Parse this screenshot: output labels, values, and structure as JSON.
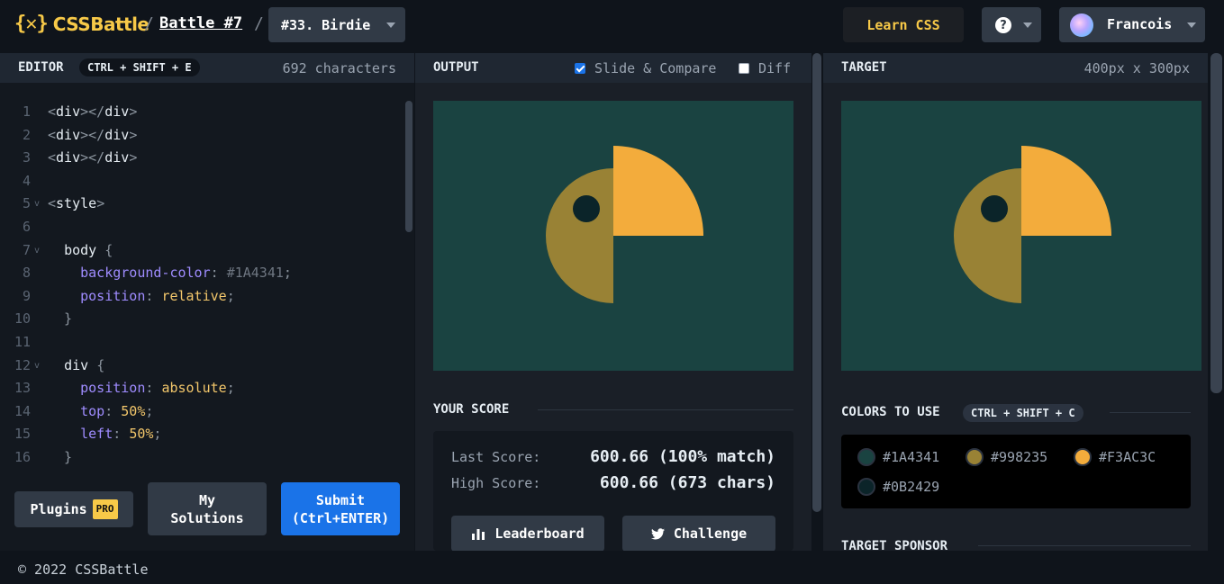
{
  "header": {
    "logo_mark": "{✕}",
    "logo_text": "CSSBattle",
    "separator": "/",
    "battle": "Battle #7",
    "target_name": "#33. Birdie",
    "learn": "Learn CSS",
    "help": "?",
    "user": "Francois"
  },
  "editor": {
    "title": "EDITOR",
    "shortcut": "CTRL + SHIFT + E",
    "chars": "692 characters",
    "lines": [
      {
        "n": "1",
        "text": "<div></div>"
      },
      {
        "n": "2",
        "text": "<div></div>"
      },
      {
        "n": "3",
        "text": "<div></div>"
      },
      {
        "n": "4",
        "text": ""
      },
      {
        "n": "5",
        "text": "<style>"
      },
      {
        "n": "6",
        "text": ""
      },
      {
        "n": "7",
        "text": "  body {"
      },
      {
        "n": "8",
        "text": "    background-color: #1A4341;"
      },
      {
        "n": "9",
        "text": "    position: relative;"
      },
      {
        "n": "10",
        "text": "  }"
      },
      {
        "n": "11",
        "text": ""
      },
      {
        "n": "12",
        "text": "  div {"
      },
      {
        "n": "13",
        "text": "    position: absolute;"
      },
      {
        "n": "14",
        "text": "    top: 50%;"
      },
      {
        "n": "15",
        "text": "    left: 50%;"
      },
      {
        "n": "16",
        "text": "  }"
      }
    ],
    "plugins": "Plugins",
    "pro": "PRO",
    "my_solutions_1": "My",
    "my_solutions_2": "Solutions",
    "submit_1": "Submit",
    "submit_2": "(Ctrl+ENTER)"
  },
  "output": {
    "title": "OUTPUT",
    "slide_compare": "Slide & Compare",
    "slide_compare_checked": true,
    "diff": "Diff",
    "diff_checked": false,
    "score_title": "YOUR SCORE",
    "last_label": "Last Score:",
    "last_value": "600.66 (100% match)",
    "high_label": "High Score:",
    "high_value": "600.66 (673 chars)",
    "leaderboard": "Leaderboard",
    "challenge": "Challenge"
  },
  "target": {
    "title": "TARGET",
    "size": "400px x 300px",
    "colors_title": "COLORS TO USE",
    "colors_shortcut": "CTRL + SHIFT + C",
    "colors": [
      "#1A4341",
      "#998235",
      "#F3AC3C",
      "#0B2429"
    ],
    "sponsor": "TARGET SPONSOR"
  },
  "footer": {
    "copyright": "© 2022 CSSBattle"
  }
}
